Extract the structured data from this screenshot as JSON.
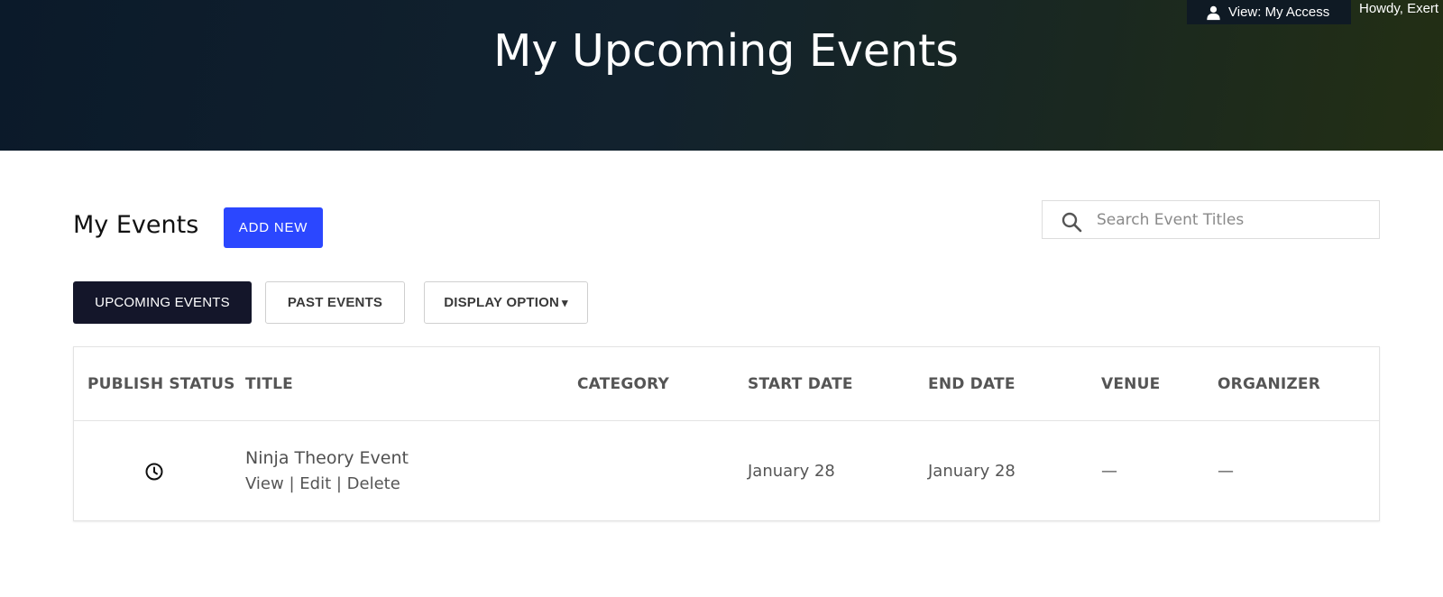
{
  "header": {
    "title": "My Upcoming Events",
    "admin_view_label": "View: My Access",
    "admin_howdy": "Howdy, Exert"
  },
  "events_section": {
    "title": "My Events",
    "add_new_label": "ADD NEW",
    "search": {
      "placeholder": "Search Event Titles",
      "value": ""
    }
  },
  "tabs": {
    "upcoming": "UPCOMING EVENTS",
    "past": "PAST EVENTS",
    "display_option": "DISPLAY OPTION",
    "display_caret": "▾"
  },
  "table": {
    "headers": {
      "status": "PUBLISH STATUS",
      "title": "TITLE",
      "category": "CATEGORY",
      "start": "START DATE",
      "end": "END DATE",
      "venue": "VENUE",
      "organizer": "ORGANIZER"
    },
    "rows": [
      {
        "status_icon": "clock-icon",
        "title": "Ninja Theory Event",
        "action_view": "View",
        "action_edit": "Edit",
        "action_delete": "Delete",
        "separator": "|",
        "category": "",
        "start": "January 28",
        "end": "January 28",
        "venue": "—",
        "organizer": "—"
      }
    ]
  },
  "colors": {
    "primary": "#2b47ff",
    "active_tab": "#14162a",
    "hero_start": "#0b1a2a",
    "hero_end": "#232f14"
  }
}
